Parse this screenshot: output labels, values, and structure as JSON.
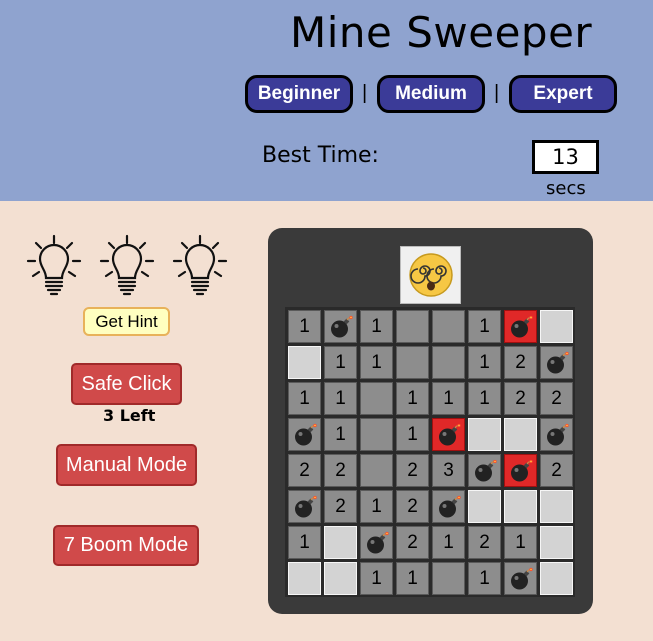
{
  "title": "Mine Sweeper",
  "levels": [
    {
      "label": "Beginner"
    },
    {
      "label": "Medium"
    },
    {
      "label": "Expert"
    }
  ],
  "separator": "|",
  "best_time": {
    "label": "Best Time:",
    "value": "13",
    "unit": "secs"
  },
  "hints": {
    "bulbs": 3,
    "button_label": "Get Hint"
  },
  "safe_click": {
    "label": "Safe Click",
    "remaining": "3 Left"
  },
  "manual_mode_label": "Manual Mode",
  "boom_mode_label": "7 Boom Mode",
  "status_face": "dizzy-face",
  "board": {
    "rows": 8,
    "cols": 8,
    "cells": [
      [
        "1",
        "M",
        "1",
        "",
        "",
        "1",
        "X",
        "H"
      ],
      [
        "H",
        "1",
        "1",
        "",
        "",
        "1",
        "2",
        "M"
      ],
      [
        "1",
        "1",
        "",
        "1",
        "1",
        "1",
        "2",
        "2"
      ],
      [
        "M",
        "1",
        "",
        "1",
        "X",
        "H",
        "H",
        "M"
      ],
      [
        "2",
        "2",
        "",
        "2",
        "3",
        "M",
        "X",
        "2"
      ],
      [
        "M",
        "2",
        "1",
        "2",
        "M",
        "H",
        "H",
        "H"
      ],
      [
        "1",
        "H",
        "M",
        "2",
        "1",
        "2",
        "1",
        "H"
      ],
      [
        "H",
        "H",
        "1",
        "1",
        "",
        "1",
        "M",
        "H"
      ]
    ],
    "legend": {
      "M": "mine",
      "X": "exploded-mine",
      "H": "hidden",
      "": "empty"
    }
  },
  "colors": {
    "header_bg": "#8fa3cf",
    "page_bg": "#f3e0d2",
    "level_button": "#3b3b98",
    "red_button": "#d04a4a",
    "board_bg": "#3a3a3a",
    "revealed_cell": "#8d8d8d",
    "hidden_cell": "#d3d3d3",
    "exploded_cell": "#e02828"
  }
}
